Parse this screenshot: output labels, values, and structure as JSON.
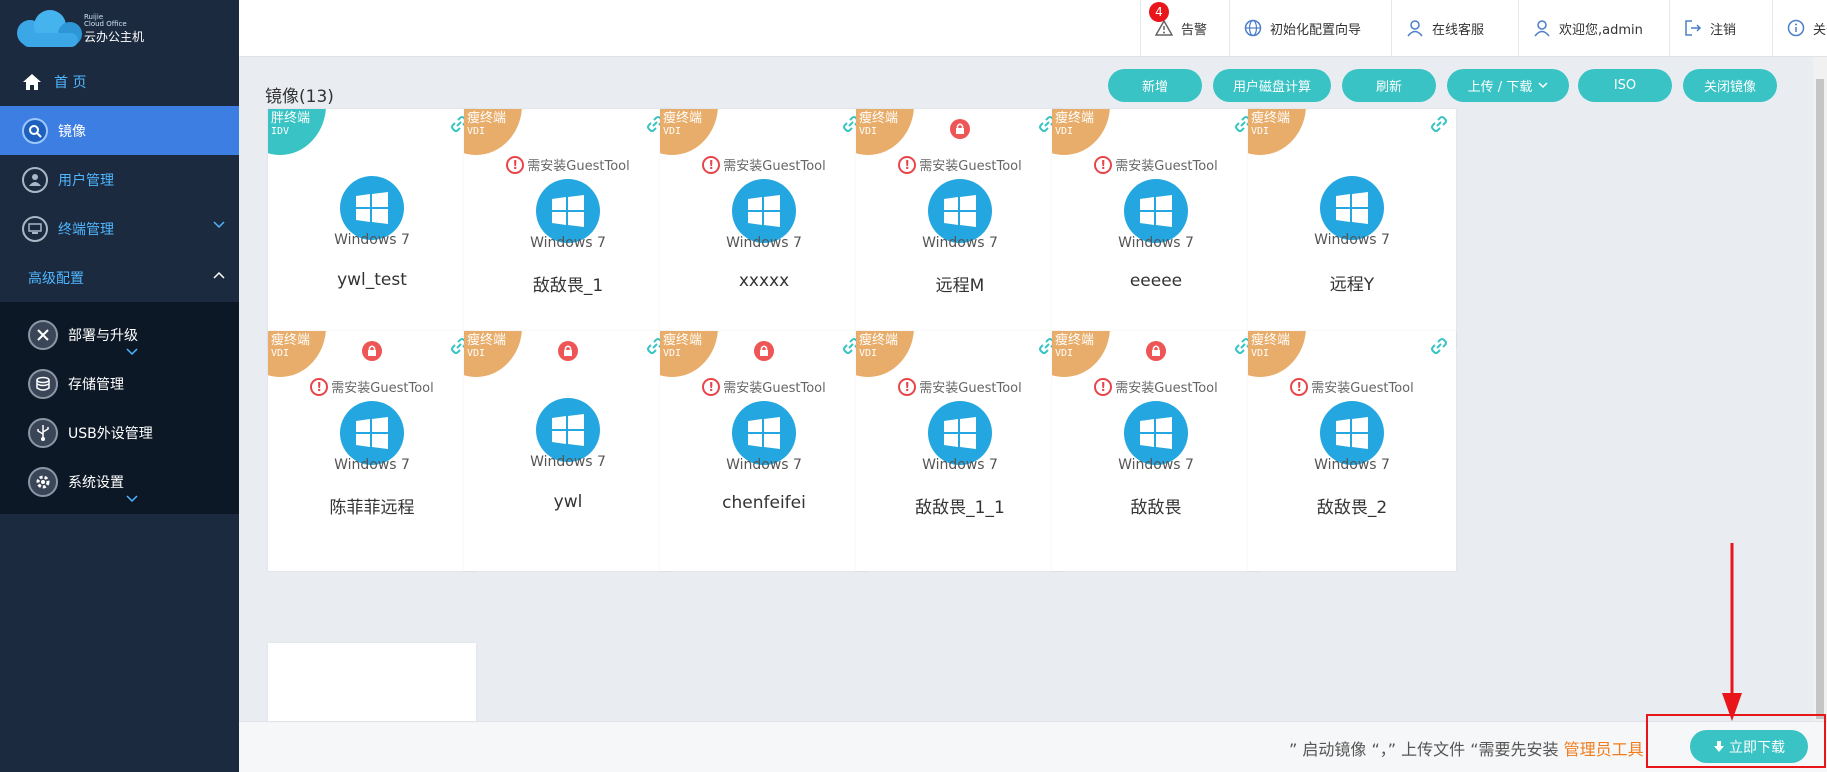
{
  "app": {
    "logo_en_1": "Ruijie",
    "logo_en_2": "Cloud Office",
    "logo_cn": "云办公主机"
  },
  "sidebar": {
    "home": "首 页",
    "image": "镜像",
    "users": "用户管理",
    "terminal": "终端管理",
    "advanced": "高级配置",
    "deploy": "部署与升级",
    "storage": "存储管理",
    "usb": "USB外设管理",
    "system": "系统设置"
  },
  "topbar": {
    "alert_count": "4",
    "alert": "告警",
    "wizard": "初始化配置向导",
    "service": "在线客服",
    "welcome": "欢迎您,admin",
    "logout": "注销",
    "about": "关于"
  },
  "main": {
    "title": "镜像(13)",
    "buttons": {
      "add": "新增",
      "disk_calc": "用户磁盘计算",
      "refresh": "刷新",
      "upload_download": "上传 / 下载",
      "iso": "ISO",
      "close_image": "关闭镜像"
    },
    "warn_text": "需安装GuestTool",
    "os_name": "Windows 7",
    "cards": [
      {
        "t1": "胖终端",
        "t2": "IDV",
        "name": "ywl_test",
        "color": "#39c3c4"
      },
      {
        "t1": "瘦终端",
        "t2": "VDI",
        "name": "敌敌畏_1",
        "color": "#e8ad6a"
      },
      {
        "t1": "瘦终端",
        "t2": "VDI",
        "name": "xxxxx",
        "color": "#e8ad6a"
      },
      {
        "t1": "瘦终端",
        "t2": "VDI",
        "name": "远程M",
        "color": "#e8ad6a"
      },
      {
        "t1": "瘦终端",
        "t2": "VDI",
        "name": "eeeee",
        "color": "#e8ad6a"
      },
      {
        "t1": "瘦终端",
        "t2": "VDI",
        "name": "远程Y",
        "color": "#e8ad6a"
      },
      {
        "t1": "瘦终端",
        "t2": "VDI",
        "name": "陈菲菲远程",
        "color": "#e8ad6a"
      },
      {
        "t1": "瘦终端",
        "t2": "VDI",
        "name": "ywl",
        "color": "#e8ad6a"
      },
      {
        "t1": "瘦终端",
        "t2": "VDI",
        "name": "chenfeifei",
        "color": "#e8ad6a"
      },
      {
        "t1": "瘦终端",
        "t2": "VDI",
        "name": "敌敌畏_1_1",
        "color": "#e8ad6a"
      },
      {
        "t1": "瘦终端",
        "t2": "VDI",
        "name": "敌敌畏",
        "color": "#e8ad6a"
      },
      {
        "t1": "瘦终端",
        "t2": "VDI",
        "name": "敌敌畏_2",
        "color": "#e8ad6a"
      }
    ]
  },
  "bottom": {
    "text": "” 启动镜像 “，” 上传文件 “需要先安装",
    "link": "管理员工具",
    "download": "立即下载"
  }
}
